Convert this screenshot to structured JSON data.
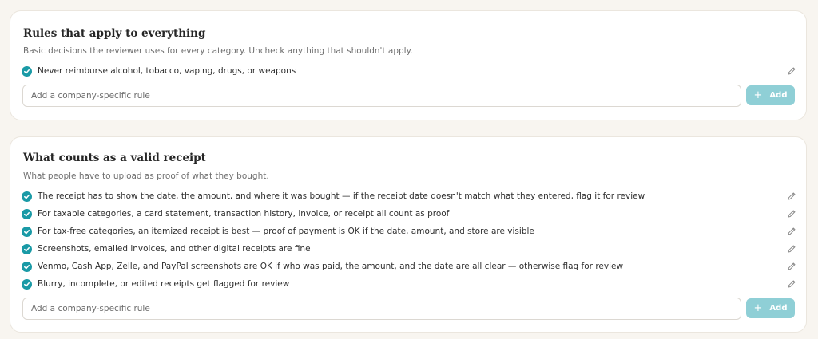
{
  "colors": {
    "accent": "#1a9aa6",
    "add_button": "#8fcfd6",
    "background": "#f8f5f0"
  },
  "sections": [
    {
      "title": "Rules that apply to everything",
      "subtitle": "Basic decisions the reviewer uses for every category. Uncheck anything that shouldn't apply.",
      "rules": [
        {
          "text": "Never reimburse alcohol, tobacco, vaping, drugs, or weapons",
          "checked": true
        }
      ],
      "input_placeholder": "Add a company-specific rule",
      "add_label": "Add"
    },
    {
      "title": "What counts as a valid receipt",
      "subtitle": "What people have to upload as proof of what they bought.",
      "rules": [
        {
          "text": "The receipt has to show the date, the amount, and where it was bought — if the receipt date doesn't match what they entered, flag it for review",
          "checked": true
        },
        {
          "text": "For taxable categories, a card statement, transaction history, invoice, or receipt all count as proof",
          "checked": true
        },
        {
          "text": "For tax-free categories, an itemized receipt is best — proof of payment is OK if the date, amount, and store are visible",
          "checked": true
        },
        {
          "text": "Screenshots, emailed invoices, and other digital receipts are fine",
          "checked": true
        },
        {
          "text": "Venmo, Cash App, Zelle, and PayPal screenshots are OK if who was paid, the amount, and the date are all clear — otherwise flag for review",
          "checked": true
        },
        {
          "text": "Blurry, incomplete, or edited receipts get flagged for review",
          "checked": true
        }
      ],
      "input_placeholder": "Add a company-specific rule",
      "add_label": "Add"
    }
  ]
}
